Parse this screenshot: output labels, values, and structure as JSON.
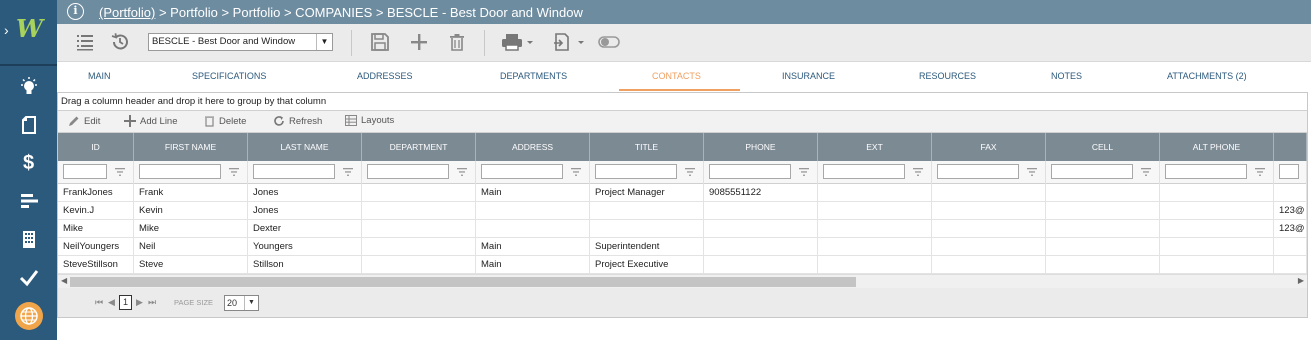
{
  "breadcrumb": {
    "link": "(Portfolio)",
    "rest": " > Portfolio > Portfolio > COMPANIES > BESCLE - Best Door and Window"
  },
  "toolbar": {
    "record_select": "BESCLE - Best Door and Window"
  },
  "tabs": [
    {
      "label": "MAIN",
      "active": false
    },
    {
      "label": "SPECIFICATIONS",
      "active": false
    },
    {
      "label": "ADDRESSES",
      "active": false
    },
    {
      "label": "DEPARTMENTS",
      "active": false
    },
    {
      "label": "CONTACTS",
      "active": true
    },
    {
      "label": "INSURANCE",
      "active": false
    },
    {
      "label": "RESOURCES",
      "active": false
    },
    {
      "label": "NOTES",
      "active": false
    },
    {
      "label": "ATTACHMENTS (2)",
      "active": false
    }
  ],
  "grid": {
    "group_hint": "Drag a column header and drop it here to group by that column",
    "actions": {
      "edit": "Edit",
      "add_line": "Add Line",
      "delete": "Delete",
      "refresh": "Refresh",
      "layouts": "Layouts"
    },
    "columns": [
      "ID",
      "FIRST NAME",
      "LAST NAME",
      "DEPARTMENT",
      "ADDRESS",
      "TITLE",
      "PHONE",
      "EXT",
      "FAX",
      "CELL",
      "ALT PHONE",
      ""
    ],
    "rows": [
      [
        "FrankJones",
        "Frank",
        "Jones",
        "",
        "Main",
        "Project Manager",
        "9085551122",
        "",
        "",
        "",
        "",
        ""
      ],
      [
        "Kevin.J",
        "Kevin",
        "Jones",
        "",
        "",
        "",
        "",
        "",
        "",
        "",
        "",
        "123@"
      ],
      [
        "Mike",
        "Mike",
        "Dexter",
        "",
        "",
        "",
        "",
        "",
        "",
        "",
        "",
        "123@"
      ],
      [
        "NeilYoungers",
        "Neil",
        "Youngers",
        "",
        "Main",
        "Superintendent",
        "",
        "",
        "",
        "",
        "",
        ""
      ],
      [
        "SteveStillson",
        "Steve",
        "Stillson",
        "",
        "Main",
        "Project Executive",
        "",
        "",
        "",
        "",
        "",
        ""
      ]
    ]
  },
  "pager": {
    "current_page": "1",
    "page_size_label": "PAGE SIZE",
    "page_size": "20"
  },
  "colors": {
    "sidebar": "#2c5a7d",
    "titlebar": "#6e8ca0",
    "tab_active": "#f0a060",
    "grid_header": "#7c8a94",
    "logo_green": "#a7d25b",
    "globe_orange": "#f0a54a"
  }
}
